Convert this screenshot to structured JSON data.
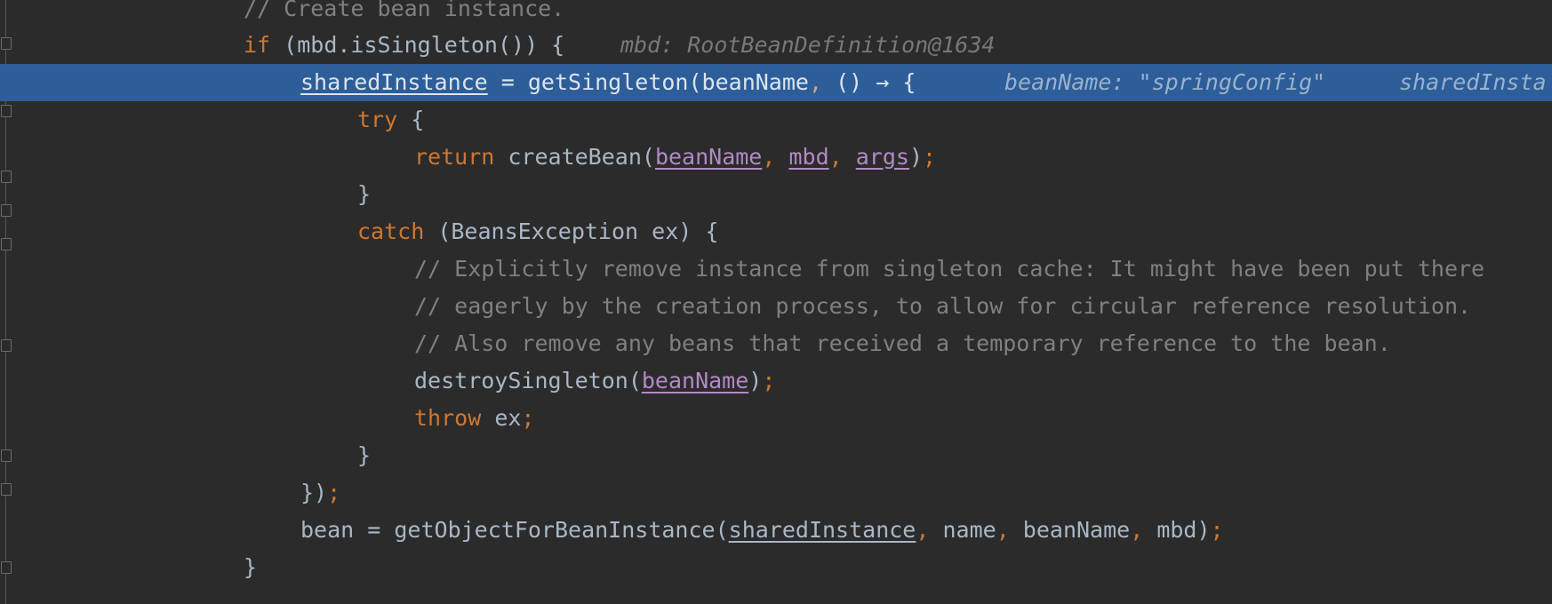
{
  "editor": {
    "theme": "darcula",
    "colors": {
      "background": "#2b2b2b",
      "highlight": "#2d5e99",
      "keyword": "#cc7832",
      "comment": "#808080",
      "parameter": "#b389c5",
      "text": "#a9b7c6"
    },
    "lines": [
      {
        "comment": "// Create bean instance."
      },
      {
        "kw": "if",
        "text": " (mbd.isSingleton()) {",
        "hint": "mbd: RootBeanDefinition@1634"
      },
      {
        "var": "sharedInstance",
        "t1": " = getSingleton(beanName",
        "comma": ",",
        "t2": " () → {",
        "hint1": "beanName: \"springConfig\"",
        "hint2": "sharedInsta"
      },
      {
        "kw": "try",
        "text": " {"
      },
      {
        "kw": "return",
        "t1": " createBean(",
        "p1": "beanName",
        "c1": ", ",
        "p2": "mbd",
        "c2": ", ",
        "p3": "args",
        "t2": ")",
        "semi": ";"
      },
      {
        "text": "}"
      },
      {
        "kw": "catch",
        "text": " (BeansException ex) {"
      },
      {
        "comment": "// Explicitly remove instance from singleton cache: It might have been put there"
      },
      {
        "comment": "// eagerly by the creation process, to allow for circular reference resolution."
      },
      {
        "comment": "// Also remove any beans that received a temporary reference to the bean."
      },
      {
        "t1": "destroySingleton(",
        "p1": "beanName",
        "t2": ")",
        "semi": ";"
      },
      {
        "kw": "throw",
        "text": " ex",
        "semi": ";"
      },
      {
        "text": "}"
      },
      {
        "text": "})",
        "semi": ";"
      },
      {
        "t1": "bean = getObjectForBeanInstance(",
        "var": "sharedInstance",
        "c1": ",",
        "t2": " name",
        "c2": ",",
        "t3": " beanName",
        "c3": ",",
        "t4": " mbd)",
        "semi": ";"
      },
      {
        "text": "}"
      }
    ]
  }
}
